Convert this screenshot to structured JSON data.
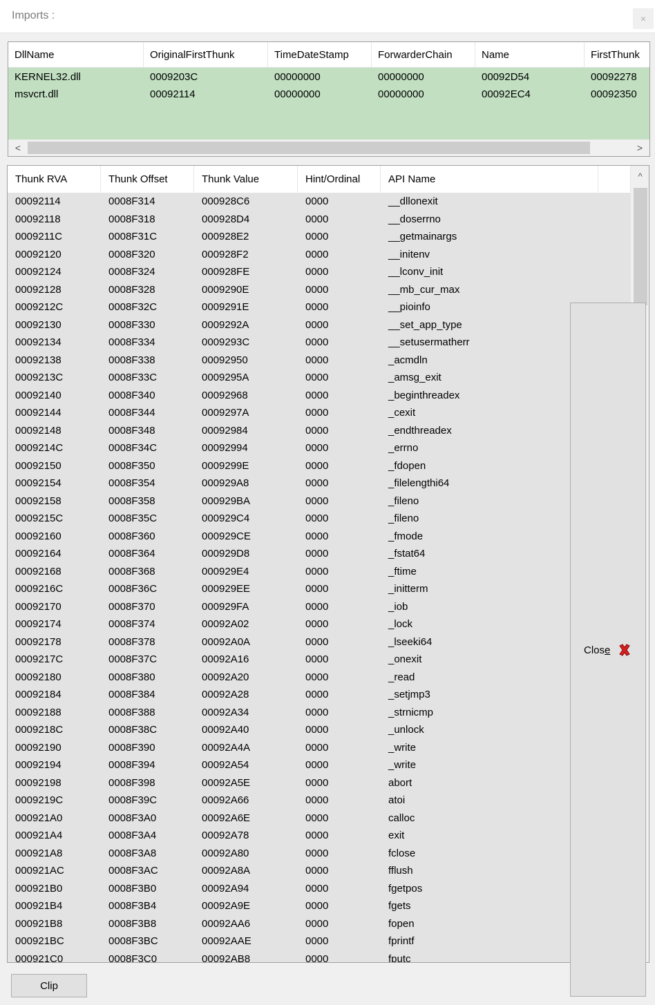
{
  "window": {
    "title": "Imports :",
    "close_glyph": "×"
  },
  "dll_table": {
    "columns": [
      "DllName",
      "OriginalFirstThunk",
      "TimeDateStamp",
      "ForwarderChain",
      "Name",
      "FirstThunk"
    ],
    "rows": [
      [
        "KERNEL32.dll",
        "0009203C",
        "00000000",
        "00000000",
        "00092D54",
        "00092278"
      ],
      [
        "msvcrt.dll",
        "00092114",
        "00000000",
        "00000000",
        "00092EC4",
        "00092350"
      ]
    ],
    "row_highlight_color": "#c2dfc2",
    "scroll_left_glyph": "<",
    "scroll_right_glyph": ">"
  },
  "thunk_table": {
    "columns": [
      "Thunk RVA",
      "Thunk Offset",
      "Thunk Value",
      "Hint/Ordinal",
      "API Name",
      ""
    ],
    "scroll_up_glyph": "^",
    "rows": [
      [
        "00092114",
        "0008F314",
        "000928C6",
        "0000",
        "__dllonexit"
      ],
      [
        "00092118",
        "0008F318",
        "000928D4",
        "0000",
        "__doserrno"
      ],
      [
        "0009211C",
        "0008F31C",
        "000928E2",
        "0000",
        "__getmainargs"
      ],
      [
        "00092120",
        "0008F320",
        "000928F2",
        "0000",
        "__initenv"
      ],
      [
        "00092124",
        "0008F324",
        "000928FE",
        "0000",
        "__lconv_init"
      ],
      [
        "00092128",
        "0008F328",
        "0009290E",
        "0000",
        "__mb_cur_max"
      ],
      [
        "0009212C",
        "0008F32C",
        "0009291E",
        "0000",
        "__pioinfo"
      ],
      [
        "00092130",
        "0008F330",
        "0009292A",
        "0000",
        "__set_app_type"
      ],
      [
        "00092134",
        "0008F334",
        "0009293C",
        "0000",
        "__setusermatherr"
      ],
      [
        "00092138",
        "0008F338",
        "00092950",
        "0000",
        "_acmdln"
      ],
      [
        "0009213C",
        "0008F33C",
        "0009295A",
        "0000",
        "_amsg_exit"
      ],
      [
        "00092140",
        "0008F340",
        "00092968",
        "0000",
        "_beginthreadex"
      ],
      [
        "00092144",
        "0008F344",
        "0009297A",
        "0000",
        "_cexit"
      ],
      [
        "00092148",
        "0008F348",
        "00092984",
        "0000",
        "_endthreadex"
      ],
      [
        "0009214C",
        "0008F34C",
        "00092994",
        "0000",
        "_errno"
      ],
      [
        "00092150",
        "0008F350",
        "0009299E",
        "0000",
        "_fdopen"
      ],
      [
        "00092154",
        "0008F354",
        "000929A8",
        "0000",
        "_filelengthi64"
      ],
      [
        "00092158",
        "0008F358",
        "000929BA",
        "0000",
        "_fileno"
      ],
      [
        "0009215C",
        "0008F35C",
        "000929C4",
        "0000",
        "_fileno"
      ],
      [
        "00092160",
        "0008F360",
        "000929CE",
        "0000",
        "_fmode"
      ],
      [
        "00092164",
        "0008F364",
        "000929D8",
        "0000",
        "_fstat64"
      ],
      [
        "00092168",
        "0008F368",
        "000929E4",
        "0000",
        "_ftime"
      ],
      [
        "0009216C",
        "0008F36C",
        "000929EE",
        "0000",
        "_initterm"
      ],
      [
        "00092170",
        "0008F370",
        "000929FA",
        "0000",
        "_iob"
      ],
      [
        "00092174",
        "0008F374",
        "00092A02",
        "0000",
        "_lock"
      ],
      [
        "00092178",
        "0008F378",
        "00092A0A",
        "0000",
        "_lseeki64"
      ],
      [
        "0009217C",
        "0008F37C",
        "00092A16",
        "0000",
        "_onexit"
      ],
      [
        "00092180",
        "0008F380",
        "00092A20",
        "0000",
        "_read"
      ],
      [
        "00092184",
        "0008F384",
        "00092A28",
        "0000",
        "_setjmp3"
      ],
      [
        "00092188",
        "0008F388",
        "00092A34",
        "0000",
        "_strnicmp"
      ],
      [
        "0009218C",
        "0008F38C",
        "00092A40",
        "0000",
        "_unlock"
      ],
      [
        "00092190",
        "0008F390",
        "00092A4A",
        "0000",
        "_write"
      ],
      [
        "00092194",
        "0008F394",
        "00092A54",
        "0000",
        "_write"
      ],
      [
        "00092198",
        "0008F398",
        "00092A5E",
        "0000",
        "abort"
      ],
      [
        "0009219C",
        "0008F39C",
        "00092A66",
        "0000",
        "atoi"
      ],
      [
        "000921A0",
        "0008F3A0",
        "00092A6E",
        "0000",
        "calloc"
      ],
      [
        "000921A4",
        "0008F3A4",
        "00092A78",
        "0000",
        "exit"
      ],
      [
        "000921A8",
        "0008F3A8",
        "00092A80",
        "0000",
        "fclose"
      ],
      [
        "000921AC",
        "0008F3AC",
        "00092A8A",
        "0000",
        "fflush"
      ],
      [
        "000921B0",
        "0008F3B0",
        "00092A94",
        "0000",
        "fgetpos"
      ],
      [
        "000921B4",
        "0008F3B4",
        "00092A9E",
        "0000",
        "fgets"
      ],
      [
        "000921B8",
        "0008F3B8",
        "00092AA6",
        "0000",
        "fopen"
      ],
      [
        "000921BC",
        "0008F3BC",
        "00092AAE",
        "0000",
        "fprintf"
      ],
      [
        "000921C0",
        "0008F3C0",
        "00092AB8",
        "0000",
        "fputc"
      ]
    ]
  },
  "buttons": {
    "close_label": "Close",
    "close_mnemonic": "e",
    "close_icon": "close-red-x-icon",
    "clip_label": "Clip"
  }
}
